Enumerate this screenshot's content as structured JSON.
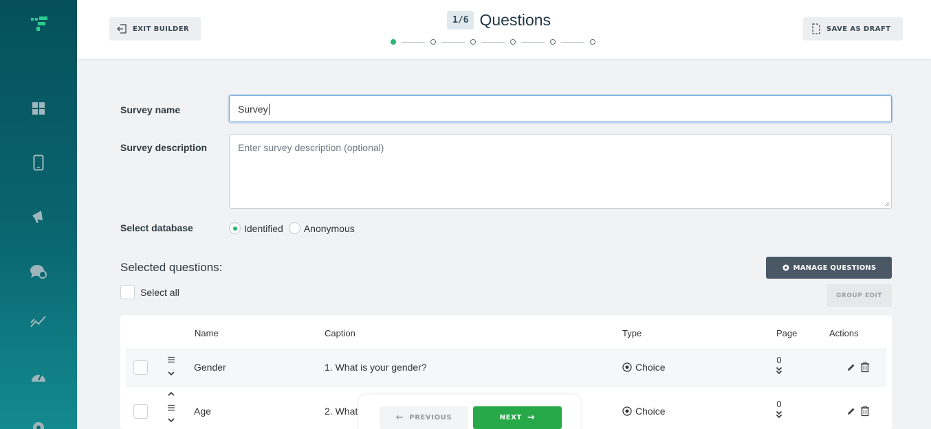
{
  "sidebar": {
    "logo": "brand-logo",
    "items": [
      {
        "icon": "dashboard-icon"
      },
      {
        "icon": "mobile-icon"
      },
      {
        "icon": "megaphone-icon"
      },
      {
        "icon": "chat-feedback-icon"
      },
      {
        "icon": "analytics-icon"
      },
      {
        "icon": "speedometer-icon"
      },
      {
        "icon": "settings-icon"
      }
    ]
  },
  "header": {
    "exit_label": "EXIT BUILDER",
    "step_badge": "1/6",
    "step_title": "Questions",
    "steps_total": 6,
    "steps_active": 1,
    "draft_label": "SAVE AS DRAFT"
  },
  "form": {
    "name_label": "Survey name",
    "name_value": "Survey",
    "description_label": "Survey description",
    "description_placeholder": "Enter survey description (optional)",
    "database_label": "Select database",
    "database_options": [
      {
        "label": "Identified",
        "selected": true
      },
      {
        "label": "Anonymous",
        "selected": false
      }
    ]
  },
  "questions": {
    "title": "Selected questions:",
    "select_all_label": "Select all",
    "manage_label": "MANAGE QUESTIONS",
    "group_edit_label": "GROUP EDIT",
    "columns": {
      "name": "Name",
      "caption": "Caption",
      "type": "Type",
      "page": "Page",
      "actions": "Actions"
    },
    "rows": [
      {
        "name": "Gender",
        "caption": "1. What is your gender?",
        "type": "Choice",
        "page": "0"
      },
      {
        "name": "Age",
        "caption": "2. What",
        "type": "Choice",
        "page": "0"
      }
    ]
  },
  "nav": {
    "previous_label": "PREVIOUS",
    "next_label": "NEXT"
  },
  "colors": {
    "sidebar": "#0a6670",
    "accent_green": "#27a94a",
    "active_dot": "#2ab573",
    "manage_button": "#4a5865"
  }
}
